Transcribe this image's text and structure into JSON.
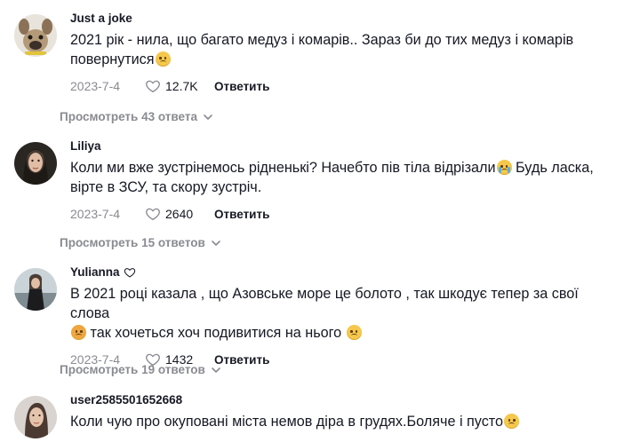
{
  "comments": [
    {
      "username": "Just a joke",
      "has_heart": false,
      "text_lines": [
        "2021 рік - нила, що багато медуз і комарів.. Зараз би до тих медуз і комарів",
        "повернутися"
      ],
      "date": "2023-7-4",
      "likes": "12.7K",
      "reply_label": "Ответить",
      "view_replies": "Просмотреть 43 ответа"
    },
    {
      "username": "Liliya",
      "has_heart": false,
      "text_lines": [
        "Коли ми вже зустрінемось рідненькі? Начебто пів тіла відрізали",
        " Будь ласка,",
        "вірте в ЗСУ, та скору зустріч."
      ],
      "date": "2023-7-4",
      "likes": "2640",
      "reply_label": "Ответить",
      "view_replies": "Просмотреть 15 ответов"
    },
    {
      "username": "Yulianna",
      "has_heart": true,
      "text_lines": [
        "В 2021 році казала , що Азовське море це болото , так шкодує тепер за свої слова",
        " так хочеться хоч подивитися на нього "
      ],
      "date": "2023-7-4",
      "likes": "1432",
      "reply_label": "Ответить",
      "view_replies": "Просмотреть 19 ответов"
    },
    {
      "username": "user2585501652668",
      "has_heart": false,
      "text_lines": [
        "Коли чую про окуповані міста немов діра в грудях.Боляче і пусто"
      ]
    }
  ],
  "icons": {
    "heart": "heart-icon",
    "chevron": "chevron-down-icon"
  },
  "colors": {
    "text": "#161823",
    "muted": "#8a8b91",
    "emoji": "#f5c84c"
  }
}
